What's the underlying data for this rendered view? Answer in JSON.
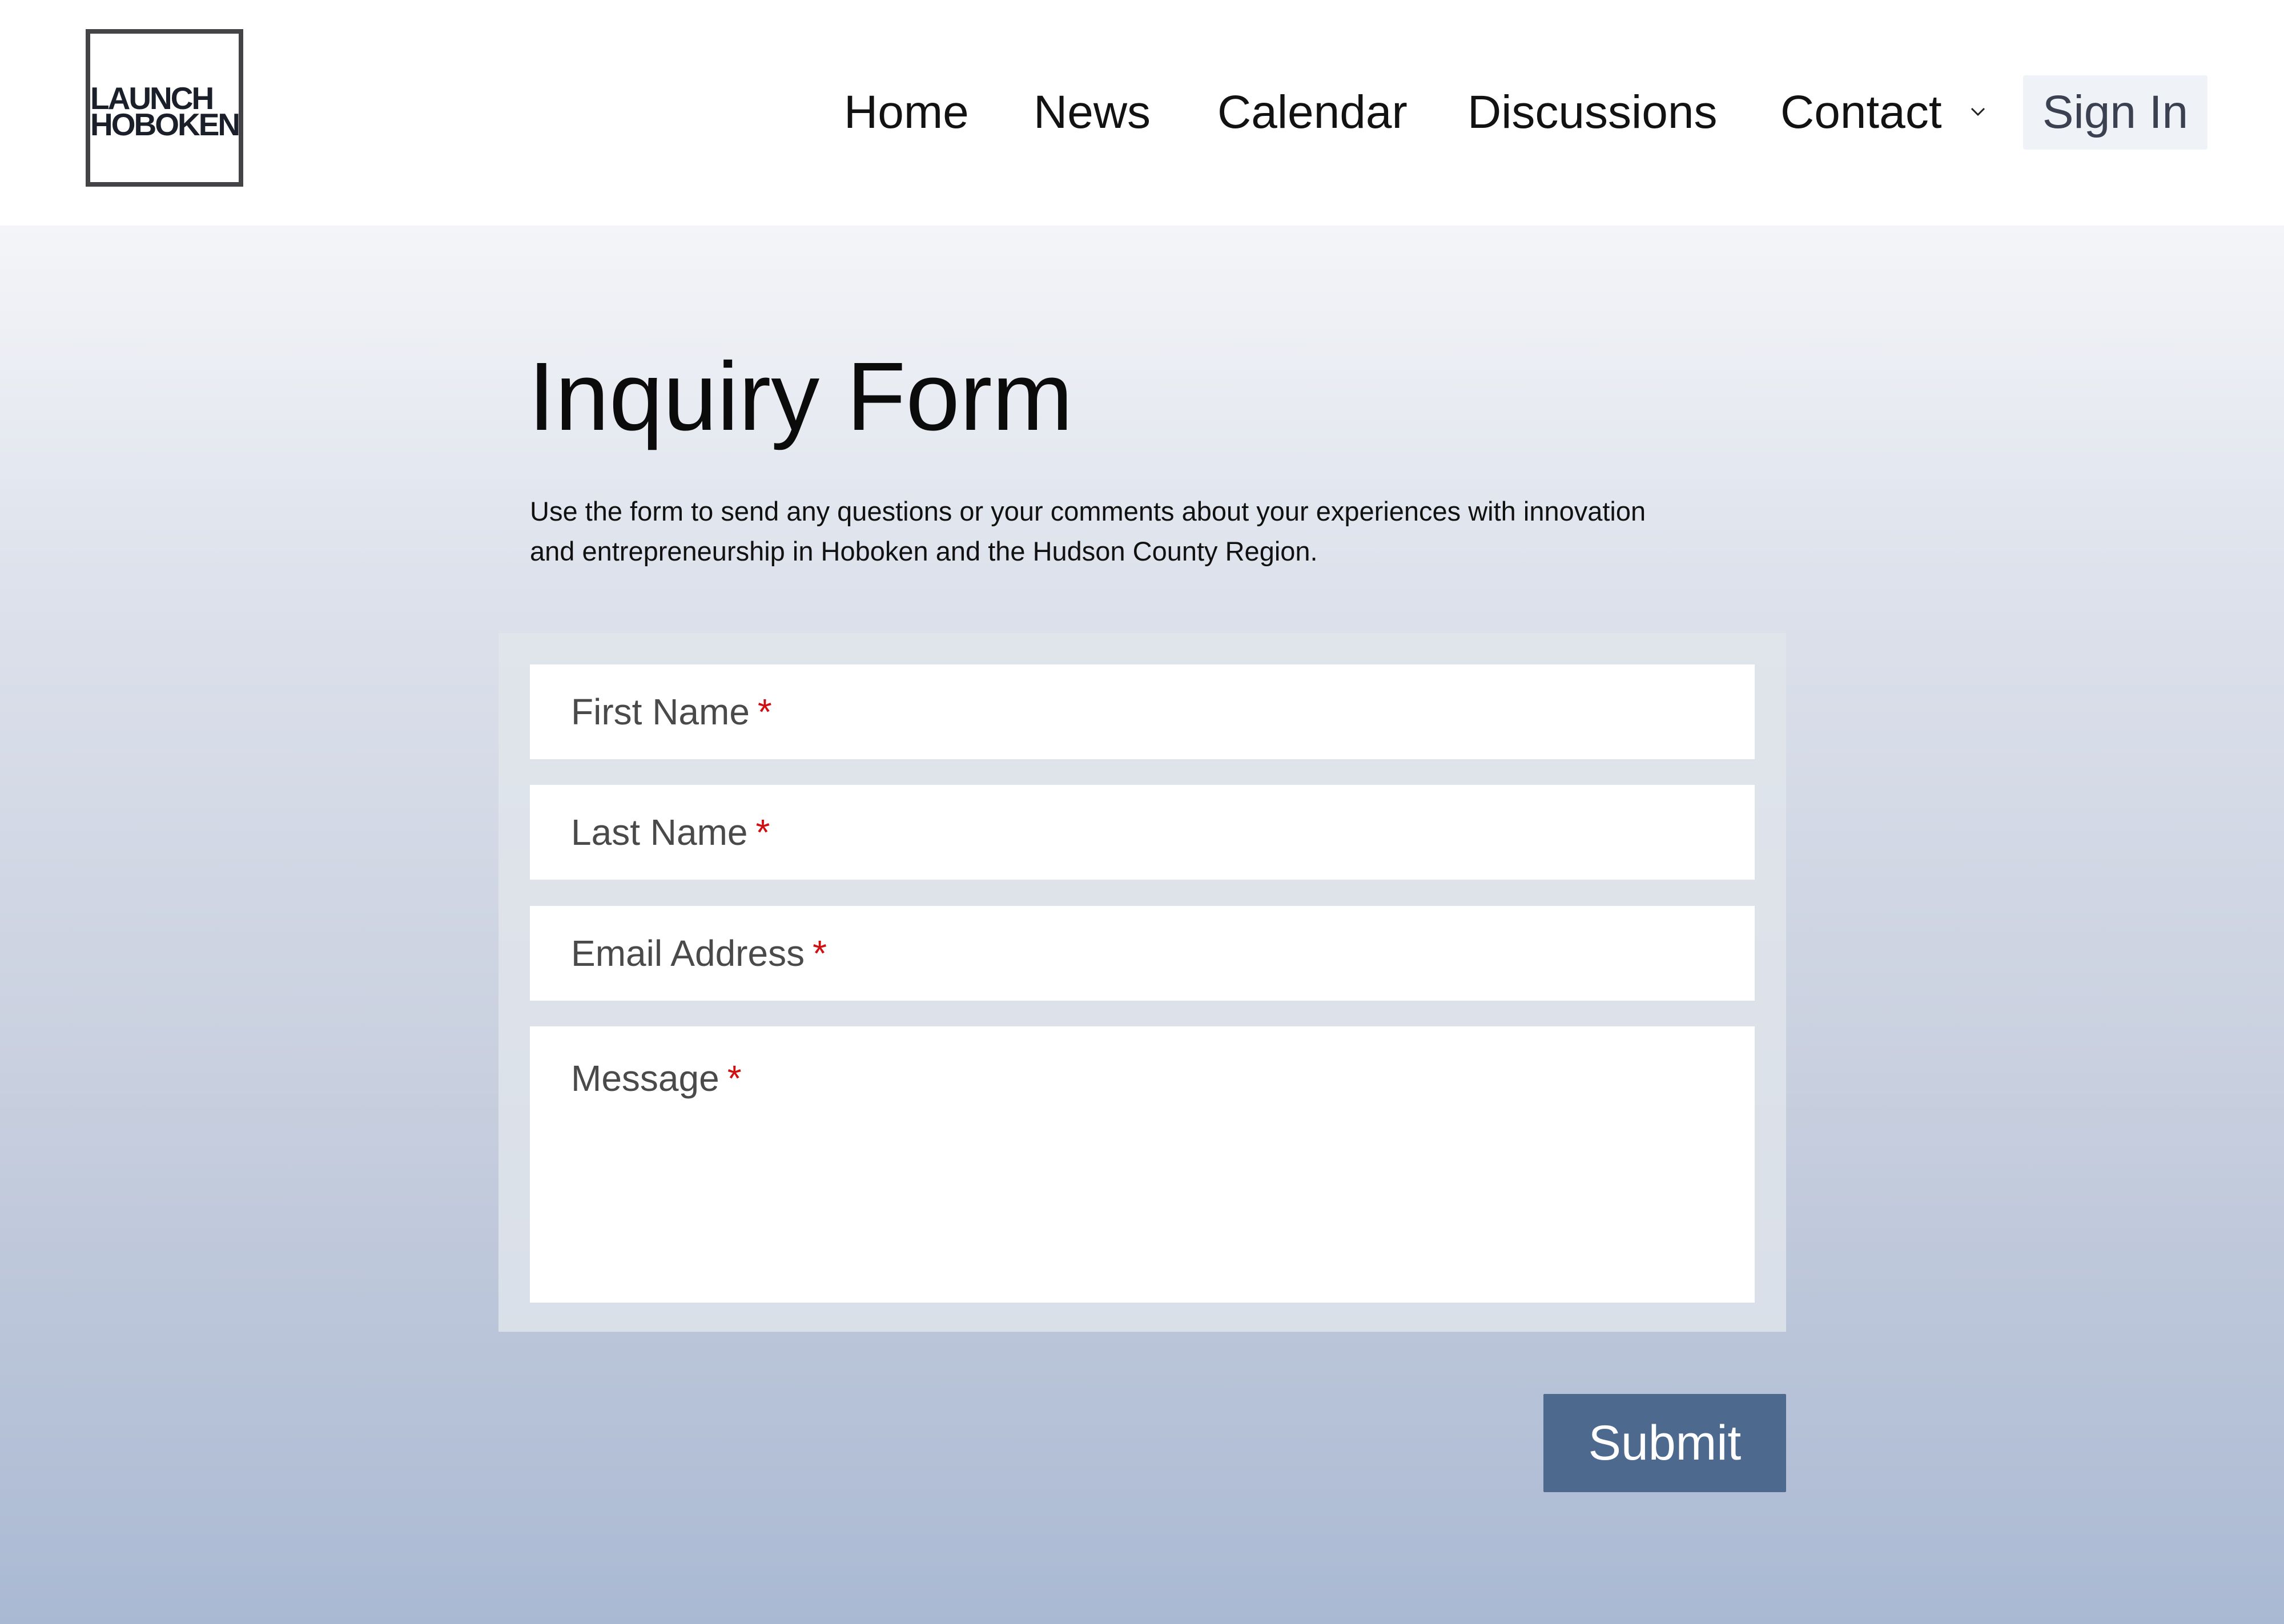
{
  "header": {
    "logo": {
      "line1": "LAUNCH",
      "line2": "HOBOKEN"
    },
    "nav": [
      {
        "label": "Home"
      },
      {
        "label": "News"
      },
      {
        "label": "Calendar"
      },
      {
        "label": "Discussions"
      },
      {
        "label": "Contact",
        "has_dropdown": true,
        "icon": "chevron-down-icon"
      }
    ],
    "sign_in": "Sign In"
  },
  "main": {
    "title": "Inquiry Form",
    "intro_line1": "Use the form to send any questions or your comments about your experiences with innovation",
    "intro_line2": "and entrepreneurship in Hoboken and the Hudson County Region.",
    "form": {
      "fields": [
        {
          "label": "First Name",
          "required_marker": "*",
          "value": ""
        },
        {
          "label": "Last Name",
          "required_marker": "*",
          "value": ""
        },
        {
          "label": "Email Address",
          "required_marker": "*",
          "value": ""
        },
        {
          "label": "Message",
          "required_marker": "*",
          "value": ""
        }
      ],
      "submit_label": "Submit"
    }
  },
  "colors": {
    "accent": "#4e698e",
    "required": "#d01010",
    "sign_in_bg": "#eff2f6"
  }
}
